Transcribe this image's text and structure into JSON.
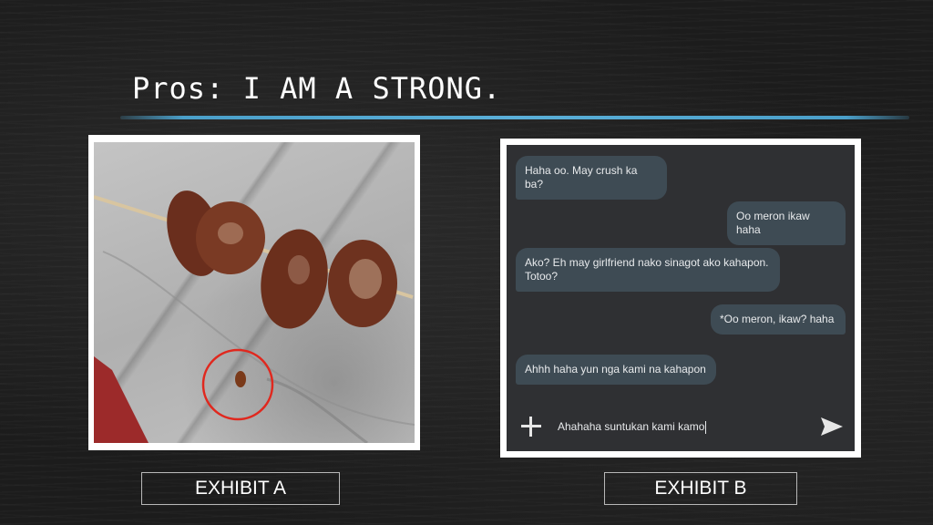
{
  "slide": {
    "title": "Pros: I AM A STRONG."
  },
  "exhibits": {
    "a_label": "EXHIBIT A",
    "b_label": "EXHIBIT B"
  },
  "chat": {
    "messages": [
      {
        "side": "in",
        "text": "Haha oo. May crush ka ba?"
      },
      {
        "side": "out",
        "text": "Oo meron ikaw haha"
      },
      {
        "side": "in",
        "text": "Ako? Eh may girlfriend nako sinagot ako kahapon. Totoo?"
      },
      {
        "side": "out",
        "text": "*Oo meron, ikaw? haha"
      },
      {
        "side": "in",
        "text": "Ahhh haha yun nga kami na kahapon"
      }
    ],
    "composer_text": "Ahahaha suntukan kami kamo",
    "icons": {
      "add": "plus-icon",
      "send": "send-icon"
    }
  },
  "colors": {
    "accent_line": "#4a9fc9",
    "chat_background": "#2f3033",
    "bubble": "#3e4b54",
    "highlight_circle": "#e0281e"
  }
}
